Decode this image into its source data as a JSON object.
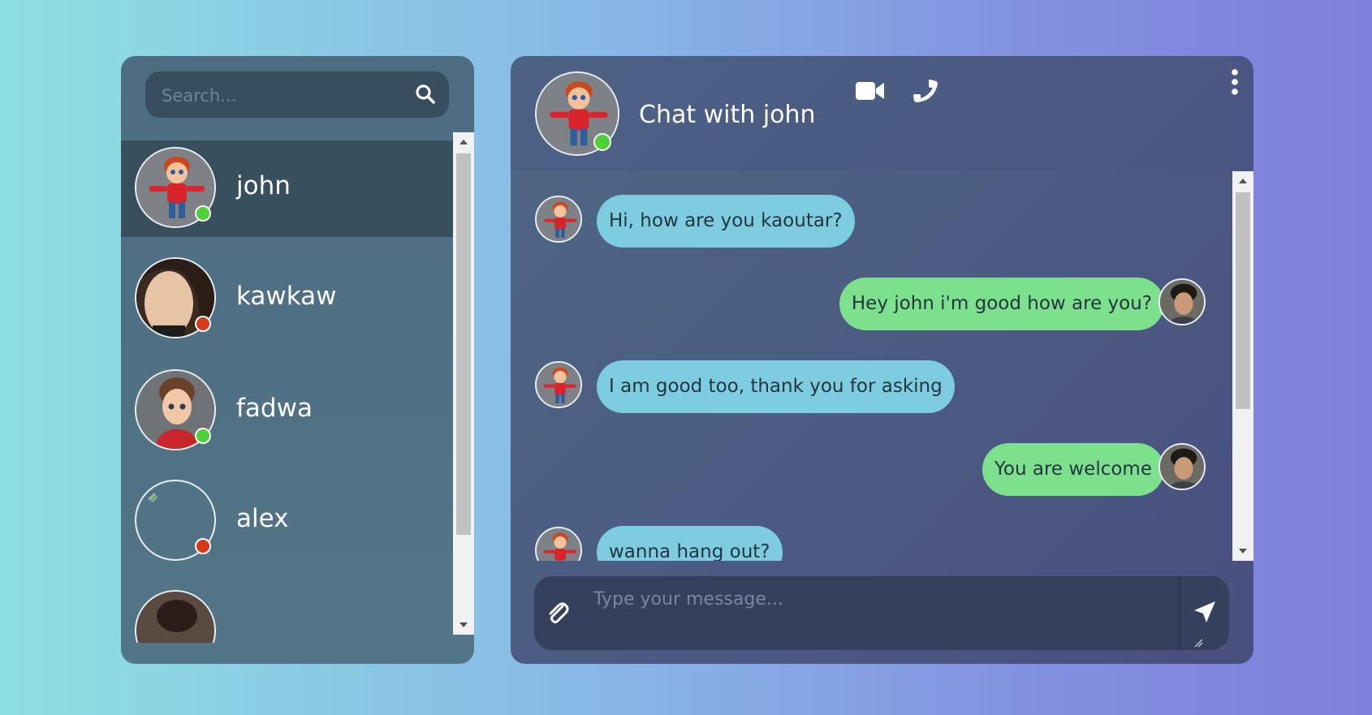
{
  "search": {
    "placeholder": "Search..."
  },
  "contacts": [
    {
      "name": "john",
      "status": "online",
      "active": true
    },
    {
      "name": "kawkaw",
      "status": "offline",
      "active": false
    },
    {
      "name": "fadwa",
      "status": "online",
      "active": false
    },
    {
      "name": "alex",
      "status": "offline",
      "active": false
    }
  ],
  "chat": {
    "title": "Chat with john",
    "contact_status": "online",
    "messages": [
      {
        "direction": "in",
        "text": "Hi, how are you kaoutar?"
      },
      {
        "direction": "out",
        "text": "Hey john i'm good how are you?"
      },
      {
        "direction": "in",
        "text": "I am good too, thank you for asking"
      },
      {
        "direction": "out",
        "text": "You are welcome"
      },
      {
        "direction": "in",
        "text": "wanna hang out?"
      }
    ]
  },
  "composer": {
    "placeholder": "Type your message..."
  },
  "colors": {
    "online": "#4cd137",
    "offline": "#d63a1a",
    "incoming_bubble": "#7ecce0",
    "outgoing_bubble": "#7ce08d",
    "active_contact": "#384f5e"
  },
  "icons": {
    "search": "search-icon",
    "video": "video-camera-icon",
    "phone": "phone-icon",
    "more": "more-vertical-icon",
    "attach": "paperclip-icon",
    "send": "send-arrow-icon"
  }
}
